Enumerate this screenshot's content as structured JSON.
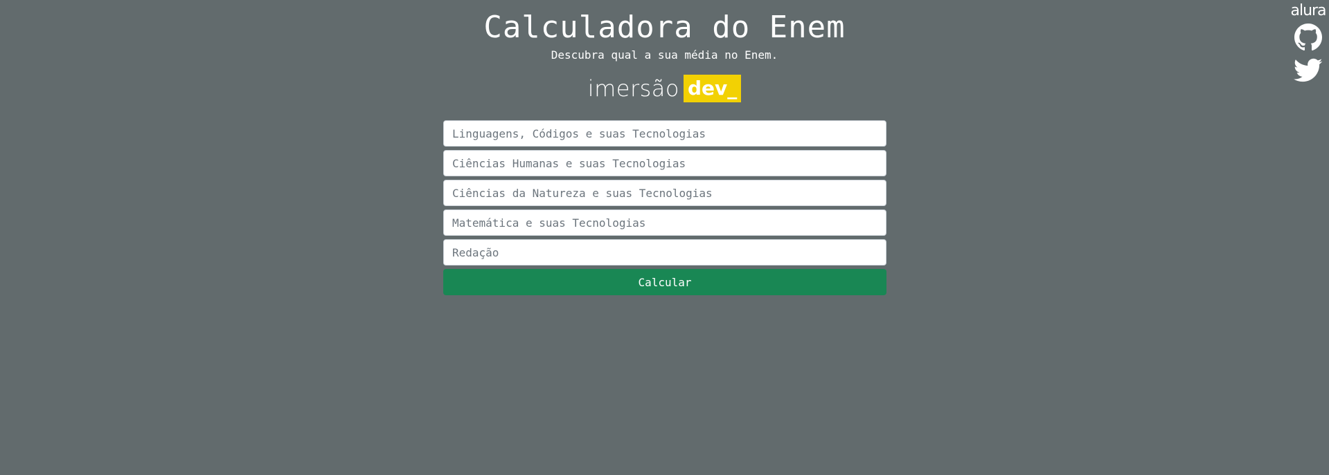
{
  "header": {
    "title": "Calculadora do Enem",
    "subtitle": "Descubra qual a sua média no Enem."
  },
  "brand": {
    "word": "imersão",
    "tag": "dev_",
    "tag_color": "#f2d103"
  },
  "form": {
    "fields": [
      {
        "placeholder": "Linguagens, Códigos e suas Tecnologias",
        "value": ""
      },
      {
        "placeholder": "Ciências Humanas e suas Tecnologias",
        "value": ""
      },
      {
        "placeholder": "Ciências da Natureza e suas Tecnologias",
        "value": ""
      },
      {
        "placeholder": "Matemática e suas Tecnologias",
        "value": ""
      },
      {
        "placeholder": "Redação",
        "value": ""
      }
    ],
    "submit_label": "Calcular",
    "submit_color": "#198754"
  },
  "social": {
    "links": [
      {
        "label": "alura",
        "icon": "alura-logo"
      },
      {
        "icon": "github-icon"
      },
      {
        "icon": "twitter-icon"
      }
    ]
  },
  "colors": {
    "background": "#626b6d",
    "text": "#ffffff"
  }
}
